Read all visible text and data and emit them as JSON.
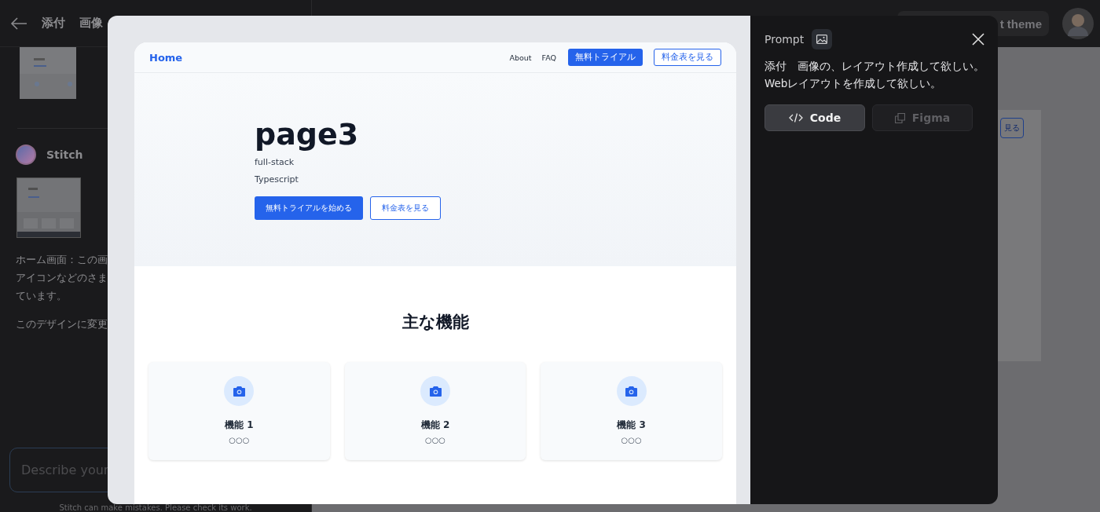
{
  "background": {
    "title_parts": [
      "添付",
      "画像"
    ],
    "sender": "Stitch",
    "message_lines": [
      "ホーム画面：この画",
      "アイコンなどのさま",
      "ています。"
    ],
    "question": "このデザインに変更",
    "input": {
      "placeholder": "Describe your"
    },
    "disclaimer": "Stitch can make mistakes. Please check its work.",
    "theme_button": "t theme",
    "canvas_button": "見る"
  },
  "modal": {
    "preview": {
      "nav": {
        "brand": "Home",
        "links": [
          "About",
          "FAQ"
        ],
        "primary": "無料トライアル",
        "secondary": "料金表を見る"
      },
      "hero": {
        "title": "page3",
        "lines": [
          "full-stack",
          "Typescript"
        ],
        "primary": "無料トライアルを始める",
        "secondary": "料金表を見る"
      },
      "features": {
        "heading": "主な機能",
        "cards": [
          {
            "title": "機能 1",
            "text": "○○○"
          },
          {
            "title": "機能 2",
            "text": "○○○"
          },
          {
            "title": "機能 3",
            "text": "○○○"
          }
        ]
      }
    },
    "prompt": {
      "label": "Prompt",
      "lines": [
        "添付　画像の、レイアウト作成して欲しい。",
        "Webレイアウトを作成して欲しい。"
      ]
    },
    "buttons": [
      {
        "kind": "code",
        "label": "Code",
        "selected": true
      },
      {
        "kind": "figma",
        "label": "Figma",
        "selected": false
      }
    ]
  }
}
